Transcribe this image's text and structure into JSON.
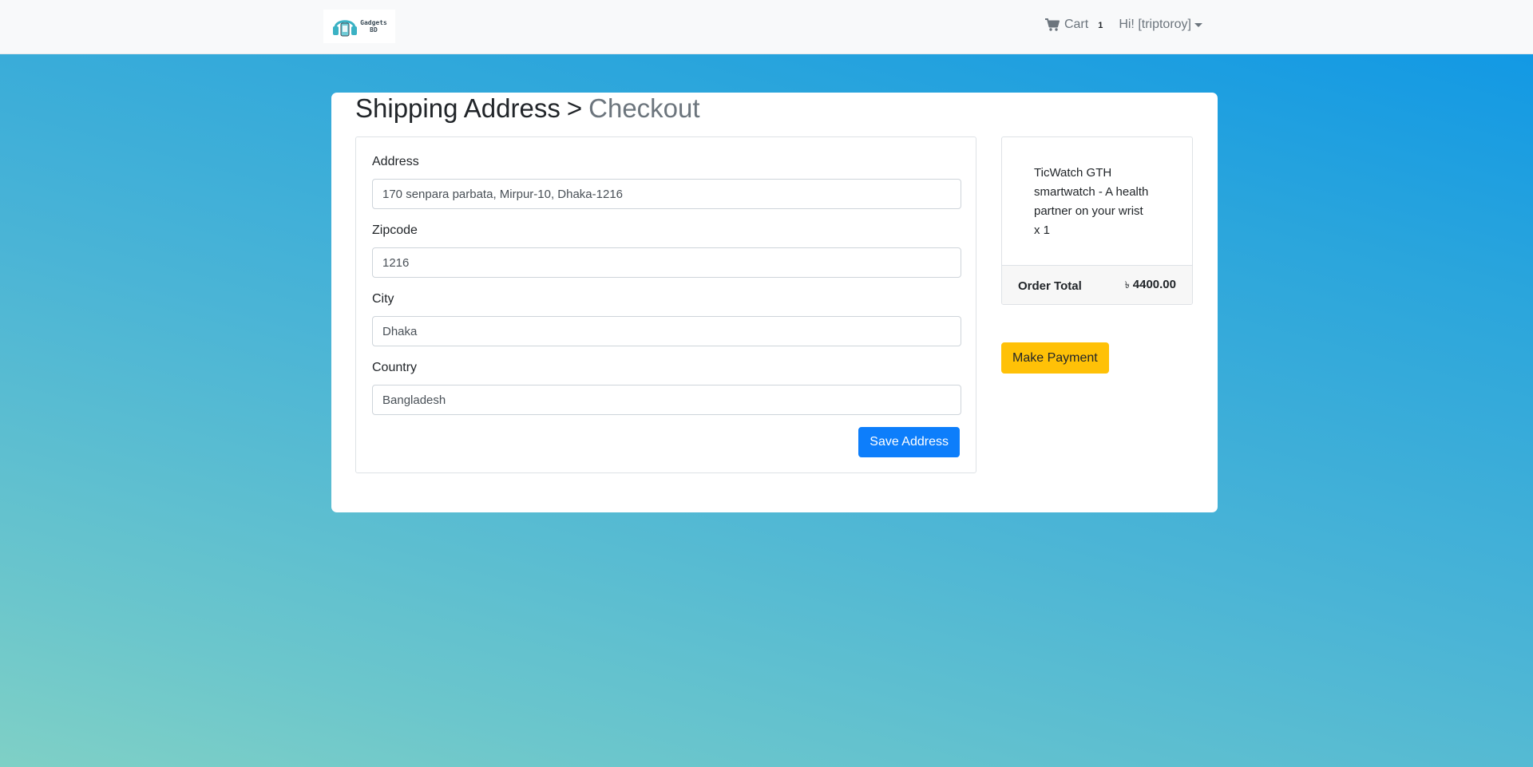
{
  "navbar": {
    "brand": {
      "logo_icon": "headphones-logo-icon",
      "logo_text_line1": "Gadgets",
      "logo_text_line2": "BD"
    },
    "cart": {
      "icon": "cart-icon",
      "label": "Cart",
      "count": "1"
    },
    "user": {
      "greeting": "Hi! [triptoroy]"
    }
  },
  "page": {
    "title_primary": "Shipping Address",
    "title_separator": ">",
    "title_secondary": "Checkout"
  },
  "form": {
    "fields": [
      {
        "label": "Address",
        "value": "170 senpara parbata, Mirpur-10, Dhaka-1216"
      },
      {
        "label": "Zipcode",
        "value": "1216"
      },
      {
        "label": "City",
        "value": "Dhaka"
      },
      {
        "label": "Country",
        "value": "Bangladesh"
      }
    ],
    "save_label": "Save Address"
  },
  "summary": {
    "item_name": "TicWatch GTH smartwatch - A health partner on your wrist",
    "item_qty": "x 1",
    "total_label": "Order Total",
    "currency_symbol": "৳",
    "total_value": "4400.00"
  },
  "payment": {
    "label": "Make Payment"
  },
  "colors": {
    "primary": "#0d7efb",
    "warning": "#ffc107",
    "navbar_bg": "#f8f9fa",
    "gradient_top": "#0d96e6",
    "gradient_bottom": "#7fd0c6"
  }
}
